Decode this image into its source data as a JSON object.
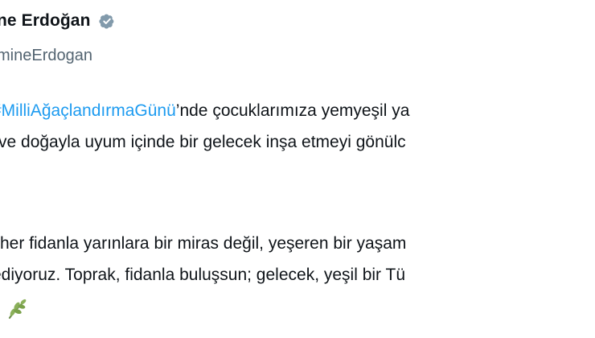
{
  "author": {
    "display_name": "ne Erdoğan",
    "handle": "mineErdogan",
    "verified_icon": "verified-badge-icon"
  },
  "tweet": {
    "line1_hashtag": "#MilliAğaçlandırmaGünü",
    "line1_rest": "’nde çocuklarımıza yemyeşil ya",
    "line2": "ve doğayla uyum içinde bir gelecek inşa etmeyi gönülc",
    "line3": "her fidanla yarınlara bir miras değil, yeşeren bir yaşam",
    "line4": "ediyoruz. Toprak, fidanla buluşsun; gelecek, yeşil bir Tü",
    "emoji_icon": "seedling-emoji-icon"
  },
  "colors": {
    "hashtag": "#1d9bf0",
    "secondary_text": "#536471",
    "verified_badge": "#829aab"
  }
}
